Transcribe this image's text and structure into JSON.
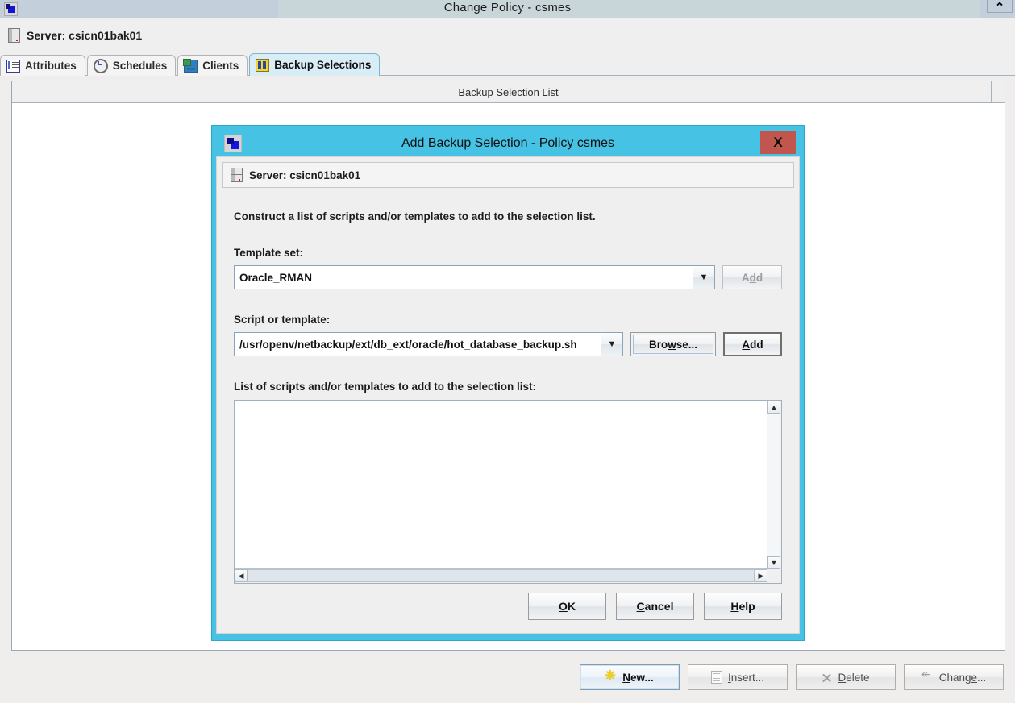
{
  "window": {
    "title": "Change Policy - csmes",
    "icon": "app-icon",
    "close_label": "⌃",
    "server_label": "Server:",
    "server_name": "csicn01bak01",
    "server_line": "Server:  csicn01bak01"
  },
  "tabs": [
    {
      "label": "Attributes",
      "icon": "attributes-icon",
      "active": false
    },
    {
      "label": "Schedules",
      "icon": "schedules-icon",
      "active": false
    },
    {
      "label": "Clients",
      "icon": "clients-icon",
      "active": false
    },
    {
      "label": "Backup Selections",
      "icon": "backup-selections-icon",
      "active": true
    }
  ],
  "table": {
    "column_header": "Backup Selection List",
    "rows": []
  },
  "toolbar": {
    "new_label": "New...",
    "new_mnemonic": "N",
    "insert_label": "Insert...",
    "insert_mnemonic": "I",
    "delete_label": "Delete",
    "delete_mnemonic": "D",
    "change_label": "Change...",
    "change_mnemonic": "e",
    "new_enabled": true,
    "insert_enabled": false,
    "delete_enabled": false,
    "change_enabled": false
  },
  "dialog": {
    "title": "Add Backup Selection - Policy csmes",
    "icon": "dialog-app-icon",
    "close_label": "X",
    "server_line": "Server:  csicn01bak01",
    "intro": "Construct a list of scripts and/or templates to add to the selection list.",
    "template_set": {
      "label": "Template set:",
      "value": "Oracle_RMAN",
      "options": [
        "Oracle_RMAN"
      ],
      "add_label": "Add",
      "add_mnemonic": "d",
      "add_enabled": false
    },
    "script": {
      "label": "Script or template:",
      "value": "/usr/openv/netbackup/ext/db_ext/oracle/hot_database_backup.sh",
      "browse_label": "Browse...",
      "browse_mnemonic": "w",
      "add_label": "Add",
      "add_mnemonic": "A",
      "add_enabled": true
    },
    "list": {
      "label": "List of scripts and/or templates to add to the selection list:",
      "items": []
    },
    "buttons": {
      "ok": "OK",
      "ok_mnemonic": "O",
      "cancel": "Cancel",
      "cancel_mnemonic": "C",
      "help": "Help",
      "help_mnemonic": "H"
    }
  },
  "colors": {
    "dialog_accent": "#46c2e4",
    "close_red": "#c0564d",
    "tab_active": "#d9edf7",
    "titlebar": "#c3cfdb"
  }
}
